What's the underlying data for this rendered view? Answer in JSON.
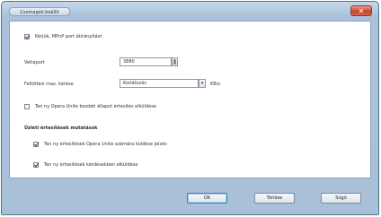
{
  "window": {
    "title": "Csomagok beállít",
    "close_label": "✕"
  },
  "upnp": {
    "label": "Kérjük, MPnP port átirányítást",
    "checked": true
  },
  "port": {
    "label": "Vetlaport",
    "value": "3880"
  },
  "upload_limit": {
    "label": "Feltöltési max. kérése",
    "value": "Korlátozás",
    "unit": "KB/s"
  },
  "notify_option": {
    "label": "Ten ny Opera Unite kezdeti állapot értesítés elküldése",
    "checked": false
  },
  "notifications": {
    "title": "Üzleti értesítések mutatások",
    "items": [
      {
        "label": "Ten ny értesítések Opera Unite számára küldése jelzés",
        "checked": true
      },
      {
        "label": "Ten ny értesítések kérdésekben elküldése",
        "checked": true
      }
    ]
  },
  "buttons": {
    "ok": "OK",
    "cancel": "Törlése",
    "help": "Súgó"
  }
}
